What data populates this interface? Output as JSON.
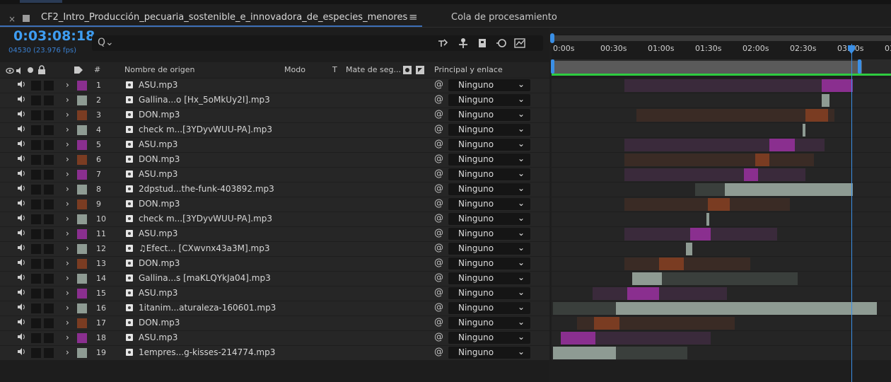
{
  "composition": {
    "tab_title": "CF2_Intro_Producción_pecuaria_sostenible_e_innovadora_de_especies_menores",
    "close_glyph": "×",
    "menu_glyph": "≡",
    "queue_tab": "Cola de procesamiento",
    "timecode": "0:03:08:18",
    "frames": "04530 (23.976 fps)",
    "search_placeholder": "",
    "search_icon": "Q⌄"
  },
  "columns": {
    "source_name": "Nombre de origen",
    "hash": "#",
    "mode": "Modo",
    "t": "T",
    "track_matte": "Mate de seg...",
    "parent_link": "Principal y enlace"
  },
  "ruler": {
    "ticks": [
      "0:00s",
      "00:30s",
      "01:00s",
      "01:30s",
      "02:00s",
      "02:30s",
      "03:00s",
      "03:"
    ]
  },
  "colors": {
    "accent": "#3e9df2",
    "playhead": "#3a8fe6",
    "workarea": "#2ecc40",
    "purple": "#8a2f8f",
    "brown": "#7a3c22",
    "gray": "#8e9b93"
  },
  "layers": [
    {
      "num": "1",
      "name": "ASU.mp3",
      "label": "purple",
      "parent": "Ninguno"
    },
    {
      "num": "2",
      "name": "Gallina...o [Hx_5oMkUy2I].mp3",
      "label": "gray",
      "parent": "Ninguno"
    },
    {
      "num": "3",
      "name": "DON.mp3",
      "label": "brown",
      "parent": "Ninguno"
    },
    {
      "num": "4",
      "name": "check m...[3YDyvWUU-PA].mp3",
      "label": "gray",
      "parent": "Ninguno"
    },
    {
      "num": "5",
      "name": "ASU.mp3",
      "label": "purple",
      "parent": "Ninguno"
    },
    {
      "num": "6",
      "name": "DON.mp3",
      "label": "brown",
      "parent": "Ninguno"
    },
    {
      "num": "7",
      "name": "ASU.mp3",
      "label": "purple",
      "parent": "Ninguno"
    },
    {
      "num": "8",
      "name": "2dpstud...the-funk-403892.mp3",
      "label": "gray",
      "parent": "Ninguno"
    },
    {
      "num": "9",
      "name": "DON.mp3",
      "label": "brown",
      "parent": "Ninguno"
    },
    {
      "num": "10",
      "name": "check m...[3YDyvWUU-PA].mp3",
      "label": "gray",
      "parent": "Ninguno"
    },
    {
      "num": "11",
      "name": "ASU.mp3",
      "label": "purple",
      "parent": "Ninguno"
    },
    {
      "num": "12",
      "name": "♫Efect... [CXwvnx43a3M].mp3",
      "label": "gray",
      "parent": "Ninguno"
    },
    {
      "num": "13",
      "name": "DON.mp3",
      "label": "brown",
      "parent": "Ninguno"
    },
    {
      "num": "14",
      "name": "Gallina...s [maKLQYkJa04].mp3",
      "label": "gray",
      "parent": "Ninguno"
    },
    {
      "num": "15",
      "name": "ASU.mp3",
      "label": "purple",
      "parent": "Ninguno"
    },
    {
      "num": "16",
      "name": "1itanim...aturaleza-160601.mp3",
      "label": "gray",
      "parent": "Ninguno"
    },
    {
      "num": "17",
      "name": "DON.mp3",
      "label": "brown",
      "parent": "Ninguno"
    },
    {
      "num": "18",
      "name": "ASU.mp3",
      "label": "purple",
      "parent": "Ninguno"
    },
    {
      "num": "19",
      "name": "1empres...g-kisses-214774.mp3",
      "label": "gray",
      "parent": "Ninguno"
    }
  ],
  "timeline": {
    "playhead_seconds": 188.75,
    "clips": [
      {
        "start": 45,
        "end": 190,
        "active_start": 170,
        "active_end": 190
      },
      {
        "start": 170,
        "end": 175,
        "active_start": 170,
        "active_end": 175
      },
      {
        "start": 53,
        "end": 178,
        "active_start": 160,
        "active_end": 174
      },
      {
        "start": 158,
        "end": 160,
        "active_start": 158,
        "active_end": 160
      },
      {
        "start": 45,
        "end": 172,
        "active_start": 137,
        "active_end": 153
      },
      {
        "start": 45,
        "end": 165,
        "active_start": 128,
        "active_end": 137
      },
      {
        "start": 45,
        "end": 160,
        "active_start": 121,
        "active_end": 130
      },
      {
        "start": 90,
        "end": 190,
        "active_start": 109,
        "active_end": 190
      },
      {
        "start": 45,
        "end": 150,
        "active_start": 98,
        "active_end": 112
      },
      {
        "start": 97,
        "end": 99,
        "active_start": 97,
        "active_end": 99
      },
      {
        "start": 45,
        "end": 142,
        "active_start": 87,
        "active_end": 100
      },
      {
        "start": 84,
        "end": 88,
        "active_start": 84,
        "active_end": 88
      },
      {
        "start": 45,
        "end": 125,
        "active_start": 67,
        "active_end": 83
      },
      {
        "start": 50,
        "end": 155,
        "active_start": 50,
        "active_end": 69
      },
      {
        "start": 25,
        "end": 110,
        "active_start": 47,
        "active_end": 67
      },
      {
        "start": 0,
        "end": 205,
        "active_start": 40,
        "active_end": 205
      },
      {
        "start": 15,
        "end": 115,
        "active_start": 26,
        "active_end": 42
      },
      {
        "start": 5,
        "end": 100,
        "active_start": 5,
        "active_end": 27
      },
      {
        "start": 0,
        "end": 85,
        "active_start": 0,
        "active_end": 40
      }
    ]
  }
}
